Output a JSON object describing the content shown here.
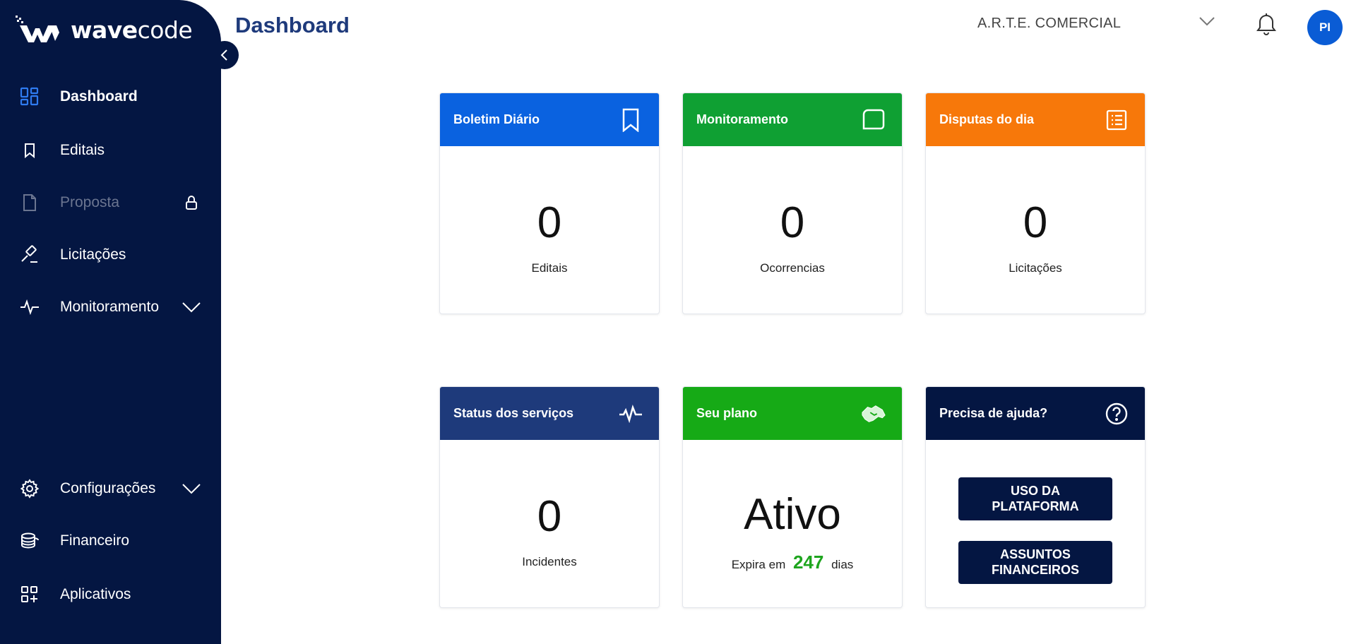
{
  "brand": {
    "name_bold": "wave",
    "name_light": "code"
  },
  "sidebar": {
    "items": [
      {
        "label": "Dashboard",
        "icon": "grid-icon",
        "active": true
      },
      {
        "label": "Editais",
        "icon": "bookmark-icon"
      },
      {
        "label": "Proposta",
        "icon": "file-icon",
        "locked": true
      },
      {
        "label": "Licitações",
        "icon": "gavel-icon"
      },
      {
        "label": "Monitoramento",
        "icon": "pulse-icon",
        "expandable": true
      }
    ],
    "bottom_items": [
      {
        "label": "Configurações",
        "icon": "gear-icon",
        "expandable": true
      },
      {
        "label": "Financeiro",
        "icon": "coins-icon"
      },
      {
        "label": "Aplicativos",
        "icon": "apps-icon"
      }
    ]
  },
  "header": {
    "title": "Dashboard",
    "company": "A.R.T.E. COMERCIAL",
    "avatar_initials": "PI"
  },
  "cards": {
    "boletim": {
      "title": "Boletim Diário",
      "value": "0",
      "label": "Editais",
      "color": "#0a62e0"
    },
    "monitoramento": {
      "title": "Monitoramento",
      "value": "0",
      "label": "Ocorrencias",
      "color": "#0fa033"
    },
    "disputas": {
      "title": "Disputas do dia",
      "value": "0",
      "label": "Licitações",
      "color": "#f7780a"
    },
    "status": {
      "title": "Status dos serviços",
      "value": "0",
      "label": "Incidentes",
      "color": "#1e3a7b"
    },
    "plano": {
      "title": "Seu plano",
      "status": "Ativo",
      "expira_prefix": "Expira em",
      "days": "247",
      "expira_suffix": "dias",
      "color": "#16aa16"
    },
    "ajuda": {
      "title": "Precisa de ajuda?",
      "btn1": "USO DA PLATAFORMA",
      "btn2": "ASSUNTOS FINANCEIROS",
      "color": "#041642"
    }
  },
  "colors": {
    "sidebar": "#041642",
    "accent": "#0a5cd5",
    "title": "#1e3a7b",
    "days": "#1ea51e"
  }
}
